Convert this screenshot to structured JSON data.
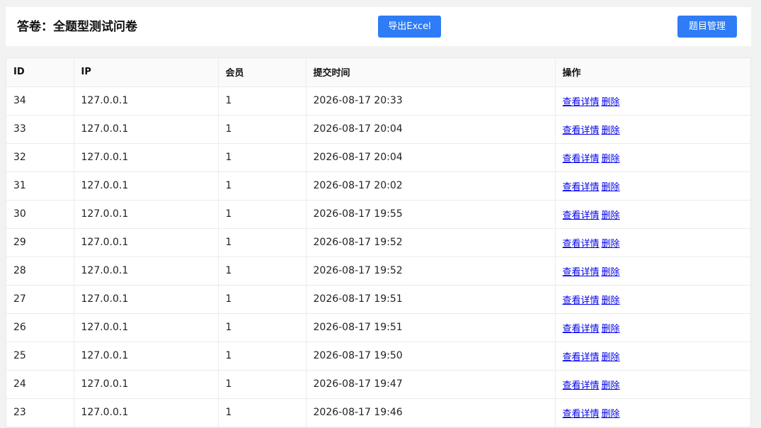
{
  "header": {
    "title": "答卷：全题型测试问卷",
    "export_label": "导出Excel",
    "manage_label": "题目管理"
  },
  "table": {
    "columns": [
      "ID",
      "IP",
      "会员",
      "提交时间",
      "操作"
    ],
    "rows": [
      {
        "id": "34",
        "ip": "127.0.0.1",
        "member": "1",
        "time": "2026-08-17 20:33"
      },
      {
        "id": "33",
        "ip": "127.0.0.1",
        "member": "1",
        "time": "2026-08-17 20:04"
      },
      {
        "id": "32",
        "ip": "127.0.0.1",
        "member": "1",
        "time": "2026-08-17 20:04"
      },
      {
        "id": "31",
        "ip": "127.0.0.1",
        "member": "1",
        "time": "2026-08-17 20:02"
      },
      {
        "id": "30",
        "ip": "127.0.0.1",
        "member": "1",
        "time": "2026-08-17 19:55"
      },
      {
        "id": "29",
        "ip": "127.0.0.1",
        "member": "1",
        "time": "2026-08-17 19:52"
      },
      {
        "id": "28",
        "ip": "127.0.0.1",
        "member": "1",
        "time": "2026-08-17 19:52"
      },
      {
        "id": "27",
        "ip": "127.0.0.1",
        "member": "1",
        "time": "2026-08-17 19:51"
      },
      {
        "id": "26",
        "ip": "127.0.0.1",
        "member": "1",
        "time": "2026-08-17 19:51"
      },
      {
        "id": "25",
        "ip": "127.0.0.1",
        "member": "1",
        "time": "2026-08-17 19:50"
      },
      {
        "id": "24",
        "ip": "127.0.0.1",
        "member": "1",
        "time": "2026-08-17 19:47"
      },
      {
        "id": "23",
        "ip": "127.0.0.1",
        "member": "1",
        "time": "2026-08-17 19:46"
      }
    ],
    "view_label": "查看详情",
    "delete_label": "删除"
  },
  "colors": {
    "accent": "#2e7cf6",
    "link": "#0000ee",
    "background": "#f2f2f2"
  }
}
